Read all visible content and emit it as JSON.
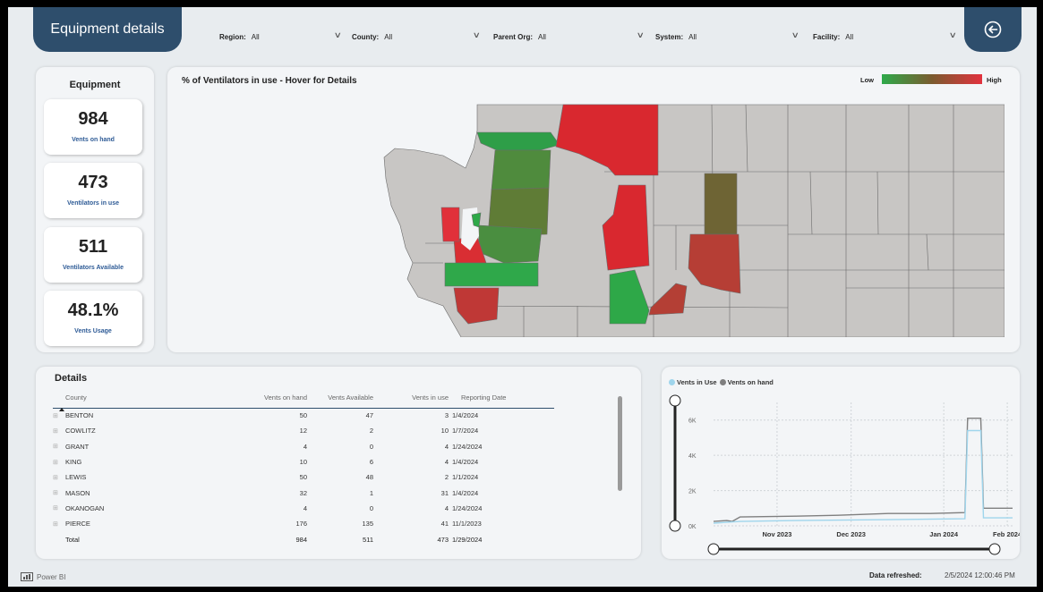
{
  "header": {
    "title": "Equipment details",
    "filters": [
      {
        "label": "Region:",
        "value": "All"
      },
      {
        "label": "County:",
        "value": "All"
      },
      {
        "label": "Parent Org:",
        "value": "All"
      },
      {
        "label": "System:",
        "value": "All"
      },
      {
        "label": "Facility:",
        "value": "All"
      }
    ],
    "back_icon": "back-arrow-circle-icon"
  },
  "equipment": {
    "title": "Equipment",
    "kpis": [
      {
        "value": "984",
        "label": "Vents on hand"
      },
      {
        "value": "473",
        "label": "Ventilators in use"
      },
      {
        "value": "511",
        "label": "Ventilators Available"
      },
      {
        "value": "48.1%",
        "label": "Vents Usage"
      }
    ]
  },
  "map": {
    "title": "% of Ventilators in use - Hover for Details",
    "legend_low": "Low",
    "legend_high": "High",
    "colors": {
      "low": "#2eaa4a",
      "mid": "#7b5b2f",
      "high": "#e2323e",
      "base": "#c8c6c4",
      "border": "#6b6b6b"
    }
  },
  "details": {
    "title": "Details",
    "columns": [
      "County",
      "Vents on hand",
      "Vents Available",
      "Vents in use",
      "Reporting Date"
    ],
    "rows": [
      {
        "county": "BENTON",
        "on_hand": "50",
        "available": "47",
        "in_use": "3",
        "date": "1/4/2024"
      },
      {
        "county": "COWLITZ",
        "on_hand": "12",
        "available": "2",
        "in_use": "10",
        "date": "1/7/2024"
      },
      {
        "county": "GRANT",
        "on_hand": "4",
        "available": "0",
        "in_use": "4",
        "date": "1/24/2024"
      },
      {
        "county": "KING",
        "on_hand": "10",
        "available": "6",
        "in_use": "4",
        "date": "1/4/2024"
      },
      {
        "county": "LEWIS",
        "on_hand": "50",
        "available": "48",
        "in_use": "2",
        "date": "1/1/2024"
      },
      {
        "county": "MASON",
        "on_hand": "32",
        "available": "1",
        "in_use": "31",
        "date": "1/4/2024"
      },
      {
        "county": "OKANOGAN",
        "on_hand": "4",
        "available": "0",
        "in_use": "4",
        "date": "1/24/2024"
      },
      {
        "county": "PIERCE",
        "on_hand": "176",
        "available": "135",
        "in_use": "41",
        "date": "11/1/2023"
      }
    ],
    "total": {
      "county": "Total",
      "on_hand": "984",
      "available": "511",
      "in_use": "473",
      "date": "1/29/2024"
    }
  },
  "chart_data": {
    "type": "line",
    "series": [
      {
        "name": "Vents in Use",
        "color": "#9fd5ec"
      },
      {
        "name": "Vents on hand",
        "color": "#7f7f7f"
      }
    ],
    "x_ticks": [
      "Nov 2023",
      "Dec 2023",
      "Jan 2024",
      "Feb 2024"
    ],
    "y_ticks": [
      "0K",
      "2K",
      "4K",
      "6K"
    ],
    "ylim": [
      0,
      7000
    ],
    "x_start": "2023-10-15",
    "x_end": "2024-02-05",
    "points_on_hand": [
      {
        "x": "2023-10-15",
        "y": 250
      },
      {
        "x": "2023-10-20",
        "y": 300
      },
      {
        "x": "2023-10-22",
        "y": 250
      },
      {
        "x": "2023-10-25",
        "y": 500
      },
      {
        "x": "2023-11-15",
        "y": 550
      },
      {
        "x": "2023-12-01",
        "y": 600
      },
      {
        "x": "2023-12-20",
        "y": 700
      },
      {
        "x": "2024-01-05",
        "y": 700
      },
      {
        "x": "2024-01-18",
        "y": 750
      },
      {
        "x": "2024-01-19",
        "y": 6100
      },
      {
        "x": "2024-01-24",
        "y": 6100
      },
      {
        "x": "2024-01-25",
        "y": 1000
      },
      {
        "x": "2024-02-05",
        "y": 1000
      }
    ],
    "points_in_use": [
      {
        "x": "2023-10-15",
        "y": 150
      },
      {
        "x": "2023-10-25",
        "y": 250
      },
      {
        "x": "2023-11-15",
        "y": 300
      },
      {
        "x": "2023-12-20",
        "y": 350
      },
      {
        "x": "2024-01-18",
        "y": 400
      },
      {
        "x": "2024-01-19",
        "y": 5400
      },
      {
        "x": "2024-01-24",
        "y": 5400
      },
      {
        "x": "2024-01-25",
        "y": 450
      },
      {
        "x": "2024-02-05",
        "y": 450
      }
    ]
  },
  "footer": {
    "logo": "Power BI",
    "refresh_label": "Data refreshed:",
    "refresh_value": "2/5/2024 12:00:46 PM"
  }
}
